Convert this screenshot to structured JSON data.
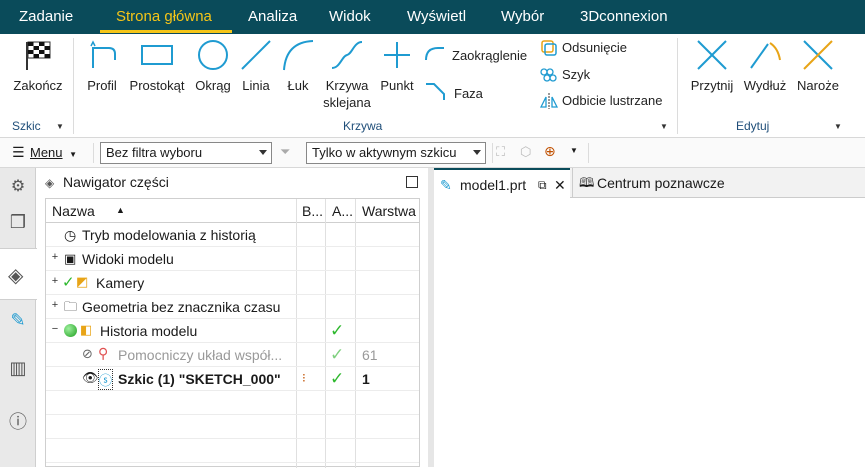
{
  "menu_tabs": [
    "Zadanie",
    "Strona główna",
    "Analiza",
    "Widok",
    "Wyświetl",
    "Wybór",
    "3Dconnexion"
  ],
  "active_tab": "Strona główna",
  "ribbon": {
    "groups": {
      "sketch": "Szkic",
      "curve": "Krzywa",
      "edit": "Edytuj"
    },
    "finish": "Zakończ",
    "profile": "Profil",
    "rectangle": "Prostokąt",
    "circle": "Okrąg",
    "line": "Linia",
    "arc": "Łuk",
    "spline_1": "Krzywa",
    "spline_2": "sklejana",
    "point": "Punkt",
    "fillet": "Zaokrąglenie",
    "chamfer": "Faza",
    "offset": "Odsunięcie",
    "pattern": "Szyk",
    "mirror": "Odbicie lustrzane",
    "trim": "Przytnij",
    "extend": "Wydłuż",
    "corner": "Naroże"
  },
  "toolbar": {
    "menu": "Menu",
    "filter": "Bez filtra wyboru",
    "scope": "Tylko w aktywnym szkicu"
  },
  "navigator": {
    "title": "Nawigator części",
    "columns": {
      "name": "Nazwa",
      "b": "B...",
      "a": "A...",
      "layer": "Warstwa"
    },
    "rows": [
      {
        "name": "Tryb modelowania z historią",
        "check": "",
        "layer": ""
      },
      {
        "name": "Widoki modelu",
        "check": "",
        "layer": ""
      },
      {
        "name": "Kamery",
        "check": "",
        "layer": ""
      },
      {
        "name": "Geometria bez znacznika czasu",
        "check": "",
        "layer": ""
      },
      {
        "name": "Historia modelu",
        "check": "✓",
        "layer": ""
      },
      {
        "name": "Pomocniczy układ współ...",
        "check": "✓",
        "layer": "61"
      },
      {
        "name": "Szkic (1) \"SKETCH_000\"",
        "check": "✓",
        "layer": "1"
      }
    ]
  },
  "doc_tabs": {
    "active": "model1.prt",
    "other": "Centrum poznawcze"
  },
  "colors": {
    "title_bar": "#0a4b5a",
    "active_tab": "#f5c518",
    "accent": "#1f9bd1",
    "check": "#2eb82e"
  }
}
